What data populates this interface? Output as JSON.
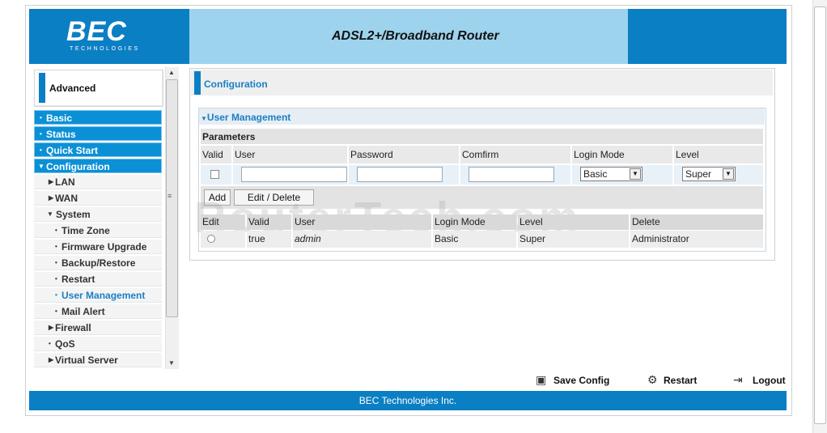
{
  "header": {
    "logo": "BEC",
    "logo_sub": "TECHNOLOGIES",
    "product": "ADSL2+/Broadband Router"
  },
  "sidebar": {
    "section": "Advanced",
    "items": [
      {
        "label": "Basic",
        "marker": "•",
        "kind": "top"
      },
      {
        "label": "Status",
        "marker": "•",
        "kind": "top"
      },
      {
        "label": "Quick Start",
        "marker": "•",
        "kind": "top"
      },
      {
        "label": "Configuration",
        "marker": "▼",
        "kind": "top"
      },
      {
        "label": "LAN",
        "marker": "▶",
        "kind": "sub1"
      },
      {
        "label": "WAN",
        "marker": "▶",
        "kind": "sub1"
      },
      {
        "label": "System",
        "marker": "▼",
        "kind": "sub1"
      },
      {
        "label": "Time Zone",
        "marker": "•",
        "kind": "sub2"
      },
      {
        "label": "Firmware Upgrade",
        "marker": "•",
        "kind": "sub2"
      },
      {
        "label": "Backup/Restore",
        "marker": "•",
        "kind": "sub2"
      },
      {
        "label": "Restart",
        "marker": "•",
        "kind": "sub2"
      },
      {
        "label": "User Management",
        "marker": "•",
        "kind": "sub2",
        "active": true
      },
      {
        "label": "Mail Alert",
        "marker": "•",
        "kind": "sub2"
      },
      {
        "label": "Firewall",
        "marker": "▶",
        "kind": "sub1"
      },
      {
        "label": "QoS",
        "marker": "•",
        "kind": "sub1"
      },
      {
        "label": "Virtual Server",
        "marker": "▶",
        "kind": "sub1"
      }
    ]
  },
  "content": {
    "title": "Configuration",
    "section_title": "User Management",
    "params_label": "Parameters",
    "columns": [
      "Valid",
      "User",
      "Password",
      "Comfirm",
      "Login Mode",
      "Level"
    ],
    "login_mode_value": "Basic",
    "level_value": "Super",
    "buttons": {
      "add": "Add",
      "edit_delete": "Edit / Delete"
    },
    "list_columns": [
      "Edit",
      "Valid",
      "User",
      "Login Mode",
      "Level",
      "Delete"
    ],
    "rows": [
      {
        "valid": "true",
        "user": "admin",
        "login_mode": "Basic",
        "level": "Super",
        "delete": "Administrator"
      }
    ]
  },
  "watermark": "RouterTech.com",
  "actions": {
    "save": "Save Config",
    "restart": "Restart",
    "logout": "Logout"
  },
  "footer": "BEC Technologies Inc.",
  "colors": {
    "brand_blue": "#0b7fc4",
    "header_light": "#9ed3ee"
  }
}
